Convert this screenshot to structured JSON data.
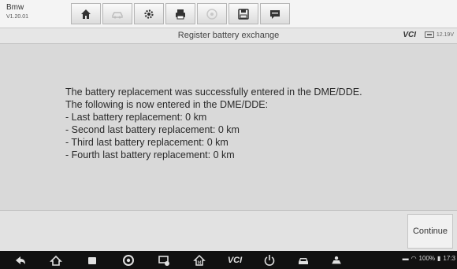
{
  "vehicle": {
    "make": "Bmw",
    "version": "V1.20.01"
  },
  "toolbar": {
    "buttons": [
      {
        "icon": "home-icon",
        "enabled": true
      },
      {
        "icon": "vehicle-swap-icon",
        "enabled": false
      },
      {
        "icon": "settings-gear-icon",
        "enabled": true
      },
      {
        "icon": "print-icon",
        "enabled": true
      },
      {
        "icon": "help-icon",
        "enabled": false
      },
      {
        "icon": "save-icon",
        "enabled": true
      },
      {
        "icon": "message-icon",
        "enabled": true
      }
    ]
  },
  "titlebar": {
    "title": "Register battery exchange",
    "vci": "VCI",
    "battery_voltage": "12.19V"
  },
  "message": {
    "lines": [
      "The battery replacement was successfully entered in the DME/DDE.",
      "The following is now entered in the DME/DDE:",
      "- Last battery replacement: 0 km",
      "- Second last battery replacement: 0 km",
      "- Third last battery replacement: 0 km",
      "- Fourth last battery replacement: 0 km"
    ]
  },
  "footer": {
    "continue_label": "Continue"
  },
  "navbar": {
    "icons": [
      "back-icon",
      "home-icon",
      "recent-apps-icon",
      "chrome-icon",
      "screen-record-icon",
      "maxisys-home-icon",
      "vci-icon",
      "power-icon",
      "car-icon",
      "technician-icon"
    ],
    "vci_label": "VCI",
    "status": {
      "battery": "100%",
      "time": "17:3"
    }
  }
}
